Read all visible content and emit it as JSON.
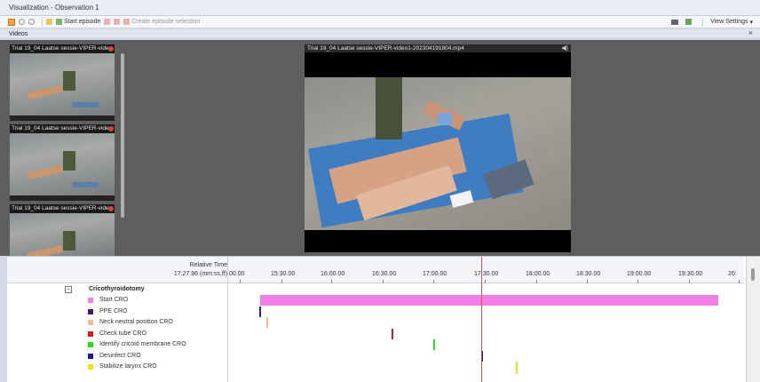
{
  "window": {
    "title": "Visualization - Observation 1"
  },
  "toolbar": {
    "start_episode": "Start episode",
    "create_episode_selection": "Create episode selection",
    "view_settings": "View Settings",
    "view_settings_arrow": "▾"
  },
  "videos_panel": {
    "title": "Videos",
    "close": "×",
    "thumbnails": [
      {
        "caption": "Trial 19_04 Laatse sessie-VIPER-vide"
      },
      {
        "caption": "Trial 19_04 Laatse sessie-VIPER-vide"
      },
      {
        "caption": "Trial 19_04 Laatse sessie-VIPER-vide"
      }
    ],
    "main_video": {
      "caption": "Trial 19_04 Laatse sessie-VIPER-video1-20230419180​4.mp4",
      "speaker": "◀)"
    }
  },
  "timeline": {
    "relative_time_label": "Relative Time",
    "relative_time_value": "17:27.96 (mm:ss,ff)",
    "ticks": [
      "00.00",
      "15:30.00",
      "16:00.00",
      "16:30.00",
      "17:00.00",
      "17:30.00",
      "18:00.00",
      "18:30.00",
      "19:00.00",
      "19:30.00",
      "20:"
    ],
    "cursor_time": "17:27.96",
    "group": {
      "label": "Cricothyroidotomy",
      "toggle": "–"
    },
    "behaviors": [
      {
        "label": "Start CRO",
        "color": "#f07ee6"
      },
      {
        "label": "PPE CRO",
        "color": "#4a1a6a"
      },
      {
        "label": "Neck neutral position CRO",
        "color": "#f2b89a"
      },
      {
        "label": "Check tube CRO",
        "color": "#d91d1d"
      },
      {
        "label": "Identify cricoid membrane CRO",
        "color": "#22dd22"
      },
      {
        "label": "Desinfect CRO",
        "color": "#1a1a8a"
      },
      {
        "label": "Stabilize larynx CRO",
        "color": "#f0e01a"
      }
    ]
  }
}
